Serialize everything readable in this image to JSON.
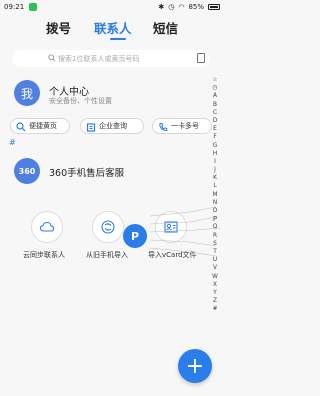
{
  "status_bar": {
    "time": "09:21",
    "battery": "85%"
  },
  "tabs": [
    {
      "label": "拨号",
      "active": false
    },
    {
      "label": "联系人",
      "active": true
    },
    {
      "label": "短信",
      "active": false
    }
  ],
  "search": {
    "placeholder": "搜索1位联系人或黄页号码"
  },
  "profile": {
    "avatar_text": "我",
    "name": "个人中心",
    "subtitle": "安全备份、个性设置"
  },
  "quick_chips": [
    {
      "label": "便捷黄页",
      "icon": "search-icon"
    },
    {
      "label": "企业查询",
      "icon": "company-icon"
    },
    {
      "label": "一卡多号",
      "icon": "phone-icon"
    }
  ],
  "section_header": "#",
  "contacts": [
    {
      "avatar_text": "360",
      "name": "360手机售后客服"
    }
  ],
  "actions": [
    {
      "label": "云同步联系人",
      "icon": "cloud-icon"
    },
    {
      "label": "从旧手机导入",
      "icon": "import-icon"
    },
    {
      "label": "导入vCard文件",
      "icon": "vcard-icon"
    }
  ],
  "index_bubble": "P",
  "index_letters": [
    "☆",
    "◷",
    "A",
    "B",
    "C",
    "D",
    "E",
    "F",
    "G",
    "H",
    "I",
    "J",
    "K",
    "L",
    "M",
    "N",
    "O",
    "P",
    "Q",
    "R",
    "S",
    "T",
    "U",
    "V",
    "W",
    "X",
    "Y",
    "Z",
    "#"
  ],
  "fab_label": "+",
  "colors": {
    "accent": "#2b7de9",
    "avatar": "#4f7fe1",
    "background": "#f7f7f7"
  }
}
